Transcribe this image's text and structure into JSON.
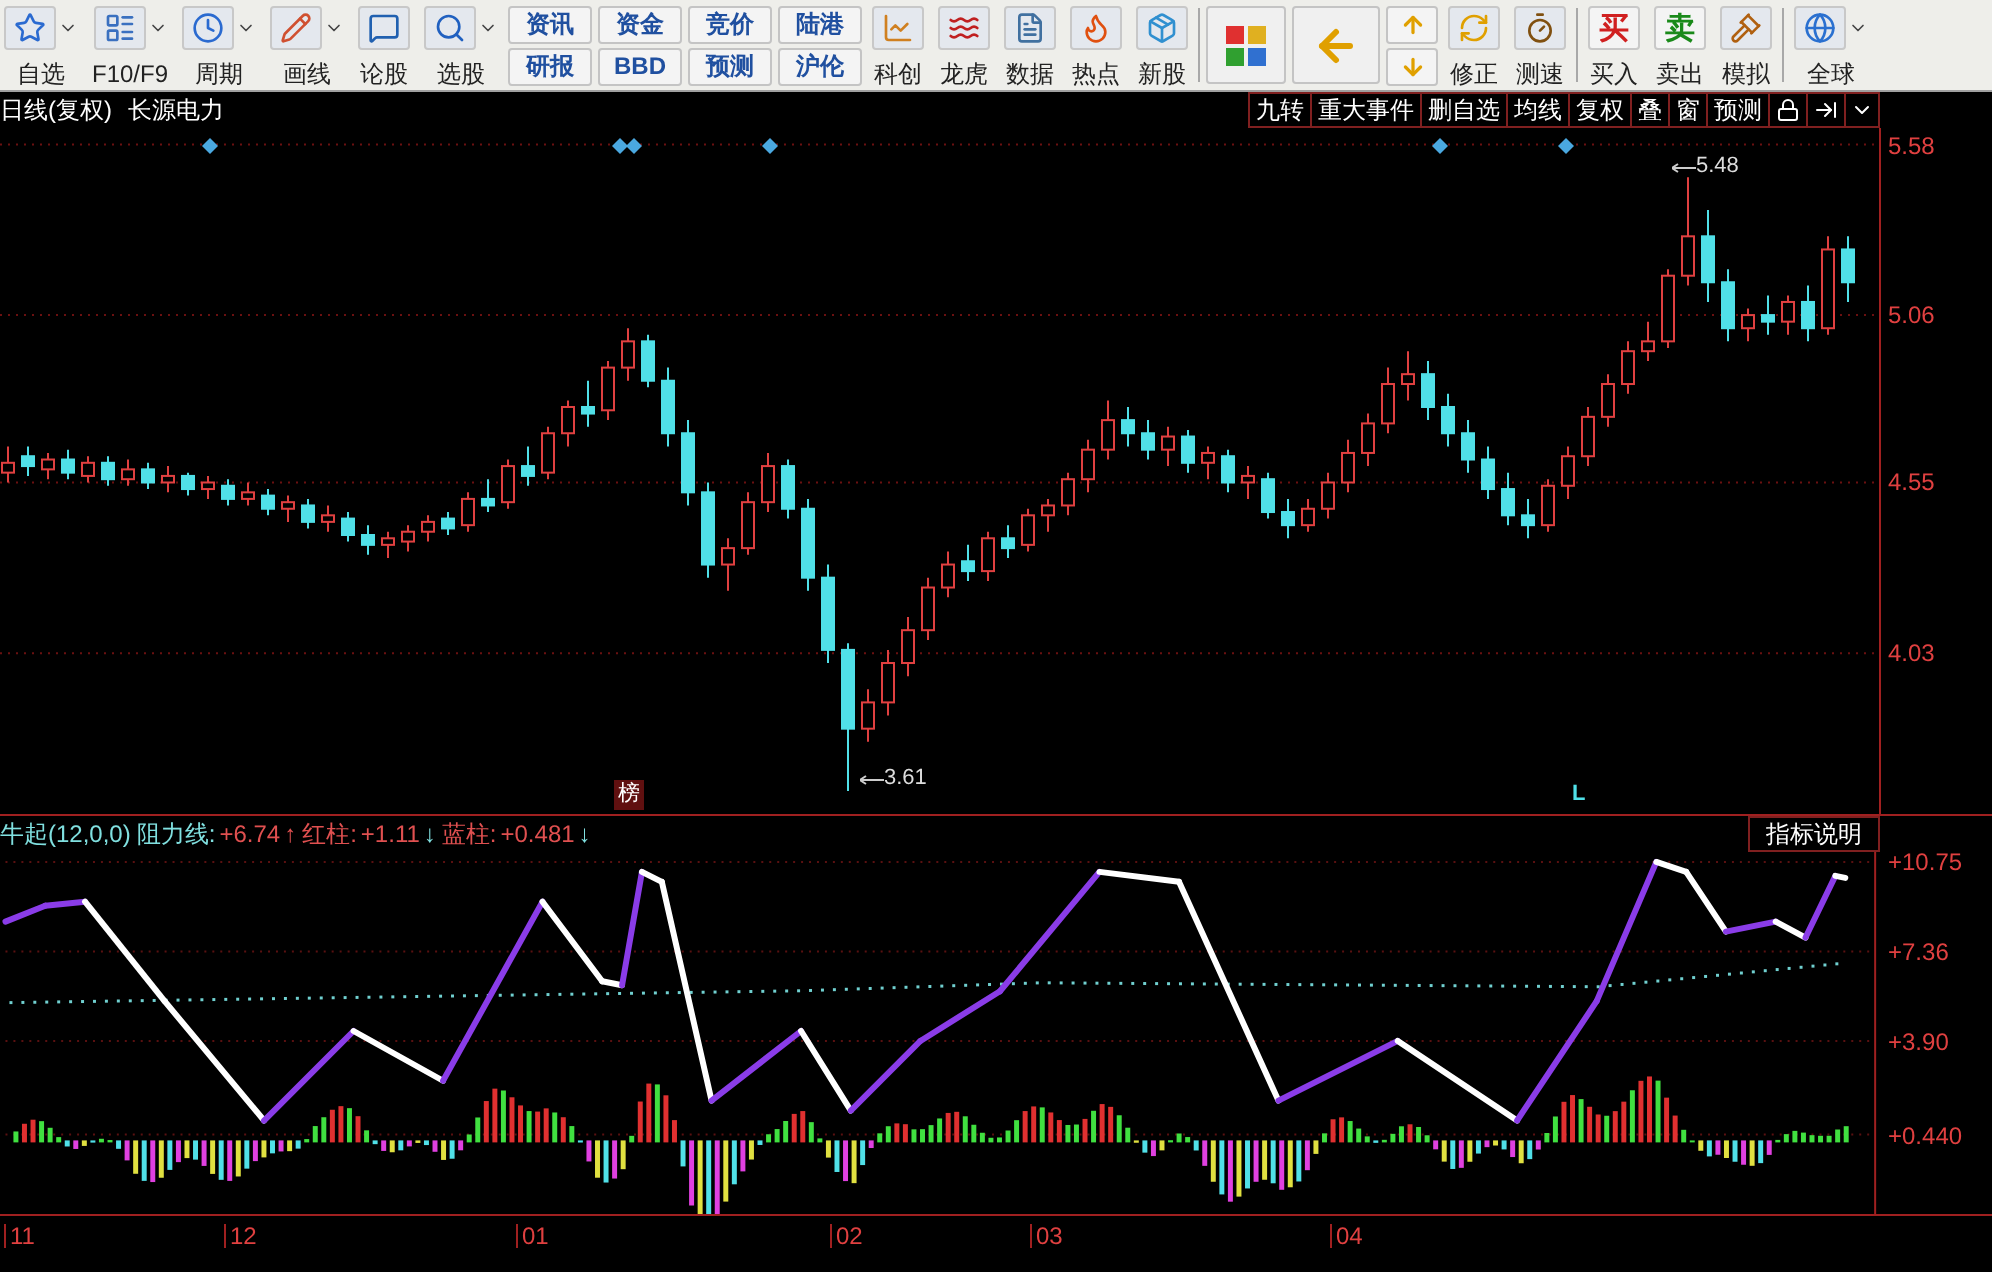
{
  "toolbar": [
    {
      "kind": "tool",
      "label": "自选",
      "menu": true
    },
    {
      "kind": "tool",
      "label": "F10/F9",
      "menu": true
    },
    {
      "kind": "tool",
      "label": "周期",
      "menu": true
    },
    {
      "kind": "tool",
      "label": "画线",
      "menu": true
    },
    {
      "kind": "tool",
      "label": "论股",
      "menu": false
    },
    {
      "kind": "tool",
      "label": "选股",
      "menu": true
    },
    {
      "kind": "pair",
      "labels": [
        "资讯",
        "研报"
      ]
    },
    {
      "kind": "pair",
      "labels": [
        "资金",
        "BBD"
      ]
    },
    {
      "kind": "pair",
      "labels": [
        "竞价",
        "预测"
      ]
    },
    {
      "kind": "pair",
      "labels": [
        "陆港",
        "沪伦"
      ]
    },
    {
      "kind": "tool",
      "label": "科创",
      "menu": false
    },
    {
      "kind": "tool",
      "label": "龙虎",
      "menu": false
    },
    {
      "kind": "tool",
      "label": "数据",
      "menu": false
    },
    {
      "kind": "tool",
      "label": "热点",
      "menu": false
    },
    {
      "kind": "tool",
      "label": "新股",
      "menu": false
    },
    {
      "kind": "separator"
    },
    {
      "kind": "big"
    },
    {
      "kind": "big"
    },
    {
      "kind": "updown"
    },
    {
      "kind": "tool",
      "label": "修正",
      "menu": false
    },
    {
      "kind": "tool",
      "label": "测速",
      "menu": false
    },
    {
      "kind": "separator"
    },
    {
      "kind": "glyph",
      "glyph": "买",
      "label": "买入",
      "color": "#d02020"
    },
    {
      "kind": "glyph",
      "glyph": "卖",
      "label": "卖出",
      "color": "#1a8a1a"
    },
    {
      "kind": "tool",
      "label": "模拟",
      "menu": false
    },
    {
      "kind": "separator"
    },
    {
      "kind": "tool",
      "label": "全球",
      "menu": true
    }
  ],
  "chart": {
    "period": "日线(复权)",
    "name": "长源电力",
    "tabs": [
      "九转",
      "重大事件",
      "删自选",
      "均线",
      "复权",
      "叠",
      "窗",
      "预测"
    ],
    "high": "5.48",
    "low": "3.61",
    "badge": "榜",
    "marker": "L",
    "chart_data": {
      "type": "candlestick",
      "ylim": [
        3.54,
        5.63
      ],
      "grid": true,
      "yticks": [
        5.58,
        5.06,
        4.55,
        4.03
      ],
      "ohlc": [
        [
          4.58,
          4.66,
          4.55,
          4.61
        ],
        [
          4.63,
          4.66,
          4.57,
          4.6
        ],
        [
          4.59,
          4.64,
          4.56,
          4.62
        ],
        [
          4.62,
          4.65,
          4.56,
          4.58
        ],
        [
          4.57,
          4.63,
          4.55,
          4.61
        ],
        [
          4.61,
          4.63,
          4.54,
          4.56
        ],
        [
          4.56,
          4.62,
          4.54,
          4.59
        ],
        [
          4.59,
          4.61,
          4.53,
          4.55
        ],
        [
          4.55,
          4.6,
          4.52,
          4.57
        ],
        [
          4.57,
          4.58,
          4.51,
          4.53
        ],
        [
          4.53,
          4.57,
          4.5,
          4.55
        ],
        [
          4.54,
          4.56,
          4.48,
          4.5
        ],
        [
          4.5,
          4.55,
          4.48,
          4.52
        ],
        [
          4.51,
          4.53,
          4.45,
          4.47
        ],
        [
          4.47,
          4.51,
          4.43,
          4.49
        ],
        [
          4.48,
          4.5,
          4.41,
          4.43
        ],
        [
          4.43,
          4.48,
          4.4,
          4.45
        ],
        [
          4.44,
          4.46,
          4.37,
          4.39
        ],
        [
          4.39,
          4.42,
          4.33,
          4.36
        ],
        [
          4.36,
          4.4,
          4.32,
          4.38
        ],
        [
          4.37,
          4.42,
          4.34,
          4.4
        ],
        [
          4.4,
          4.45,
          4.37,
          4.43
        ],
        [
          4.44,
          4.46,
          4.39,
          4.41
        ],
        [
          4.42,
          4.52,
          4.4,
          4.5
        ],
        [
          4.5,
          4.56,
          4.46,
          4.48
        ],
        [
          4.49,
          4.62,
          4.47,
          4.6
        ],
        [
          4.6,
          4.66,
          4.54,
          4.57
        ],
        [
          4.58,
          4.72,
          4.56,
          4.7
        ],
        [
          4.7,
          4.8,
          4.66,
          4.78
        ],
        [
          4.78,
          4.86,
          4.72,
          4.76
        ],
        [
          4.77,
          4.92,
          4.74,
          4.9
        ],
        [
          4.9,
          5.02,
          4.86,
          4.98
        ],
        [
          4.98,
          5.0,
          4.84,
          4.86
        ],
        [
          4.86,
          4.9,
          4.66,
          4.7
        ],
        [
          4.7,
          4.74,
          4.48,
          4.52
        ],
        [
          4.52,
          4.55,
          4.26,
          4.3
        ],
        [
          4.3,
          4.38,
          4.22,
          4.35
        ],
        [
          4.35,
          4.52,
          4.33,
          4.49
        ],
        [
          4.49,
          4.64,
          4.46,
          4.6
        ],
        [
          4.6,
          4.62,
          4.44,
          4.47
        ],
        [
          4.47,
          4.5,
          4.22,
          4.26
        ],
        [
          4.26,
          4.3,
          4.0,
          4.04
        ],
        [
          4.04,
          4.06,
          3.61,
          3.8
        ],
        [
          3.8,
          3.92,
          3.76,
          3.88
        ],
        [
          3.88,
          4.04,
          3.84,
          4.0
        ],
        [
          4.0,
          4.14,
          3.96,
          4.1
        ],
        [
          4.1,
          4.26,
          4.07,
          4.23
        ],
        [
          4.23,
          4.34,
          4.2,
          4.3
        ],
        [
          4.31,
          4.36,
          4.25,
          4.28
        ],
        [
          4.28,
          4.4,
          4.25,
          4.38
        ],
        [
          4.38,
          4.42,
          4.32,
          4.35
        ],
        [
          4.36,
          4.47,
          4.34,
          4.45
        ],
        [
          4.45,
          4.5,
          4.4,
          4.48
        ],
        [
          4.48,
          4.58,
          4.45,
          4.56
        ],
        [
          4.56,
          4.68,
          4.52,
          4.65
        ],
        [
          4.65,
          4.8,
          4.62,
          4.74
        ],
        [
          4.74,
          4.78,
          4.66,
          4.7
        ],
        [
          4.7,
          4.74,
          4.62,
          4.65
        ],
        [
          4.65,
          4.72,
          4.6,
          4.69
        ],
        [
          4.69,
          4.71,
          4.58,
          4.61
        ],
        [
          4.61,
          4.66,
          4.56,
          4.64
        ],
        [
          4.63,
          4.65,
          4.52,
          4.55
        ],
        [
          4.55,
          4.6,
          4.5,
          4.57
        ],
        [
          4.56,
          4.58,
          4.44,
          4.46
        ],
        [
          4.46,
          4.5,
          4.38,
          4.42
        ],
        [
          4.42,
          4.5,
          4.4,
          4.47
        ],
        [
          4.47,
          4.58,
          4.44,
          4.55
        ],
        [
          4.55,
          4.68,
          4.52,
          4.64
        ],
        [
          4.64,
          4.76,
          4.6,
          4.73
        ],
        [
          4.73,
          4.9,
          4.7,
          4.85
        ],
        [
          4.85,
          4.95,
          4.8,
          4.88
        ],
        [
          4.88,
          4.92,
          4.74,
          4.78
        ],
        [
          4.78,
          4.82,
          4.66,
          4.7
        ],
        [
          4.7,
          4.74,
          4.58,
          4.62
        ],
        [
          4.62,
          4.66,
          4.5,
          4.53
        ],
        [
          4.53,
          4.58,
          4.42,
          4.45
        ],
        [
          4.45,
          4.5,
          4.38,
          4.42
        ],
        [
          4.42,
          4.56,
          4.4,
          4.54
        ],
        [
          4.54,
          4.66,
          4.5,
          4.63
        ],
        [
          4.63,
          4.78,
          4.6,
          4.75
        ],
        [
          4.75,
          4.88,
          4.72,
          4.85
        ],
        [
          4.85,
          4.98,
          4.82,
          4.95
        ],
        [
          4.95,
          5.04,
          4.92,
          4.98
        ],
        [
          4.98,
          5.2,
          4.96,
          5.18
        ],
        [
          5.18,
          5.48,
          5.15,
          5.3
        ],
        [
          5.3,
          5.38,
          5.1,
          5.16
        ],
        [
          5.16,
          5.2,
          4.98,
          5.02
        ],
        [
          5.02,
          5.08,
          4.98,
          5.06
        ],
        [
          5.06,
          5.12,
          5.0,
          5.04
        ],
        [
          5.04,
          5.12,
          5.0,
          5.1
        ],
        [
          5.1,
          5.15,
          4.98,
          5.02
        ],
        [
          5.02,
          5.3,
          5.0,
          5.26
        ],
        [
          5.26,
          5.3,
          5.1,
          5.16
        ]
      ]
    }
  },
  "indicator": {
    "name": "牛起(12,0,0)",
    "values": [
      {
        "label": "阻力线:",
        "value": "+6.74",
        "arrow": "↑",
        "color": "#80e0e0"
      },
      {
        "label": "红柱:",
        "value": "+1.11",
        "arrow": "↓",
        "color": "#e05050"
      },
      {
        "label": "蓝柱:",
        "value": "+0.481",
        "arrow": "↓",
        "color": "#e05050"
      }
    ],
    "button": "指标说明",
    "axis": [
      "+10.75",
      "+7.36",
      "+3.90",
      "+0.440"
    ]
  },
  "date_axis": [
    "11",
    "12",
    "01",
    "02",
    "03",
    "04"
  ]
}
